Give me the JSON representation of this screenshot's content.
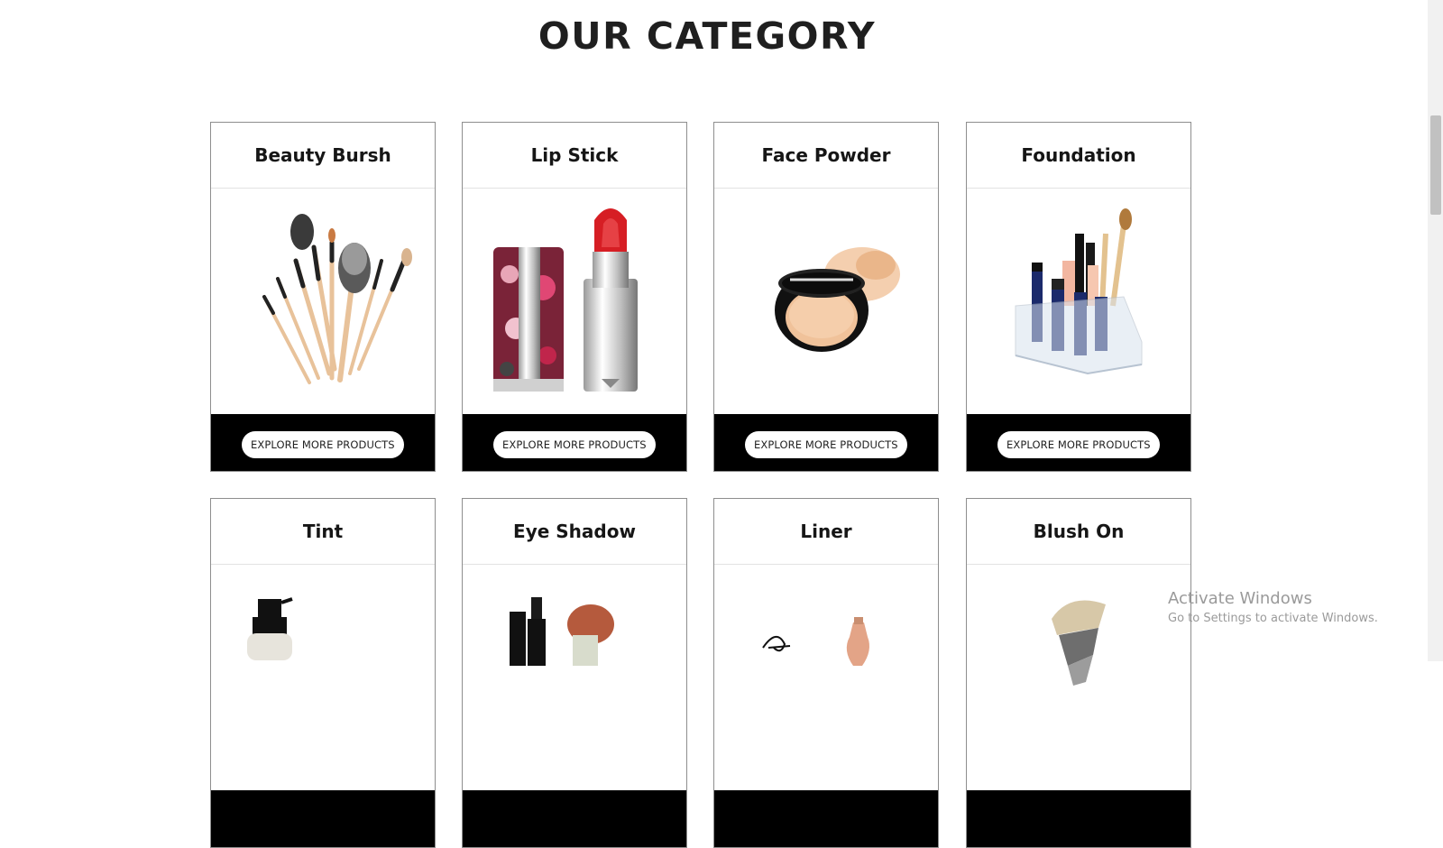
{
  "page": {
    "title": "OUR CATEGORY"
  },
  "categories": [
    {
      "name": "Beauty Bursh",
      "button_label": "EXPLORE MORE PRODUCTS",
      "image_icon": "makeup-brushes-icon"
    },
    {
      "name": "Lip Stick",
      "button_label": "EXPLORE MORE PRODUCTS",
      "image_icon": "lipstick-icon"
    },
    {
      "name": "Face Powder",
      "button_label": "EXPLORE MORE PRODUCTS",
      "image_icon": "powder-compact-icon"
    },
    {
      "name": "Foundation",
      "button_label": "EXPLORE MORE PRODUCTS",
      "image_icon": "makeup-organizer-icon"
    },
    {
      "name": "Tint",
      "image_icon": "spray-bottle-icon"
    },
    {
      "name": "Eye Shadow",
      "image_icon": "mascara-brush-icon"
    },
    {
      "name": "Liner",
      "image_icon": "eyeliner-icon"
    },
    {
      "name": "Blush On",
      "image_icon": "kabuki-brush-icon"
    }
  ],
  "os_watermark": {
    "title": "Activate Windows",
    "subtitle": "Go to Settings to activate Windows."
  },
  "colors": {
    "card_footer": "#000000",
    "button_bg": "#ffffff",
    "border": "#8e8e8e"
  }
}
